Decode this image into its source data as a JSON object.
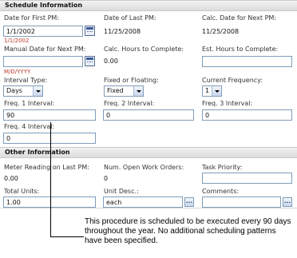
{
  "schedule": {
    "header": "Schedule Information",
    "date_first_pm": {
      "label": "Date for First PM:",
      "value": "1/1/2002",
      "echo": "1/1/2002"
    },
    "date_last_pm": {
      "label": "Date of Last PM:",
      "value": "11/25/2008"
    },
    "calc_date_next_pm": {
      "label": "Calc. Date for Next PM:",
      "value": "11/25/2008"
    },
    "manual_date_next_pm": {
      "label": "Manual Date for Next PM:",
      "value": "",
      "format_hint": "M/D/YYYY"
    },
    "calc_hours": {
      "label": "Calc. Hours to Complete:",
      "value": "0.00"
    },
    "est_hours": {
      "label": "Est. Hours to Complete:",
      "value": ""
    },
    "interval_type": {
      "label": "Interval Type:",
      "value": "Days"
    },
    "fixed_floating": {
      "label": "Fixed or Floating:",
      "value": "Fixed"
    },
    "current_frequency": {
      "label": "Current Frequency:",
      "value": "1"
    },
    "freq1": {
      "label": "Freq. 1 Interval:",
      "value": "90"
    },
    "freq2": {
      "label": "Freq. 2 Interval:",
      "value": "0"
    },
    "freq3": {
      "label": "Freq. 3 Interval:",
      "value": "0"
    },
    "freq4": {
      "label": "Freq. 4 Interval:",
      "value": "0"
    }
  },
  "other": {
    "header": "Other Information",
    "meter_reading": {
      "label": "Meter Reading on Last PM:",
      "value": "0.00"
    },
    "open_work_orders": {
      "label": "Num. Open Work Orders:",
      "value": "0"
    },
    "task_priority": {
      "label": "Task Priority:",
      "value": ""
    },
    "total_units": {
      "label": "Total Units:",
      "value": "1.00"
    },
    "unit_desc": {
      "label": "Unit Desc.:",
      "value": "each"
    },
    "comments": {
      "label": "Comments:",
      "value": ""
    },
    "lookup_glyph": "..."
  },
  "callout": {
    "text": "This procedure is scheduled to be executed every 90 days throughout the year. No additional scheduling patterns have been specified."
  },
  "colors": {
    "hint_red": "#c0392b",
    "field_border": "#7f9db9"
  },
  "icons": {
    "calendar": "calendar-icon",
    "dropdown": "chevron-down-icon",
    "lookup": "ellipsis-icon"
  }
}
